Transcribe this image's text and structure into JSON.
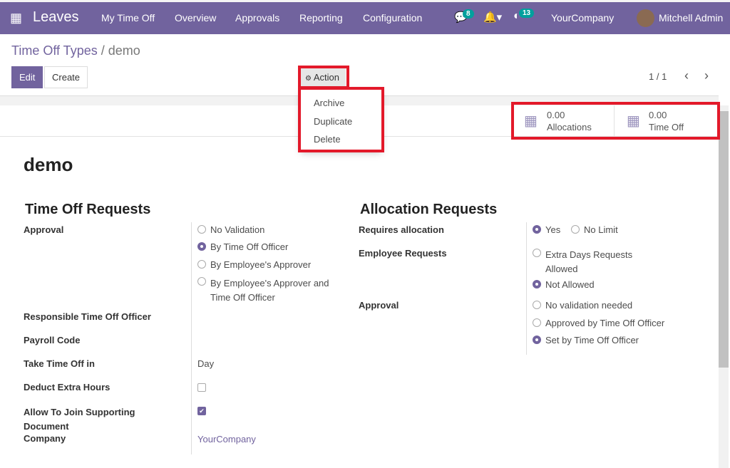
{
  "nav": {
    "app": "Leaves",
    "menu": [
      "My Time Off",
      "Overview",
      "Approvals",
      "Reporting",
      "Configuration"
    ],
    "messages_count": "8",
    "activities_count": "13",
    "company": "YourCompany",
    "user": "Mitchell Admin"
  },
  "breadcrumb": {
    "parent": "Time Off Types",
    "current": "demo"
  },
  "toolbar": {
    "edit": "Edit",
    "create": "Create",
    "action": "Action",
    "pager": "1 / 1"
  },
  "action_menu": [
    "Archive",
    "Duplicate",
    "Delete"
  ],
  "smart_buttons": [
    {
      "value": "0.00",
      "label": "Allocations"
    },
    {
      "value": "0.00",
      "label": "Time Off"
    }
  ],
  "record": {
    "name": "demo"
  },
  "left": {
    "title": "Time Off Requests",
    "approval_label": "Approval",
    "approval_options": [
      "No Validation",
      "By Time Off Officer",
      "By Employee's Approver",
      "By Employee's Approver and Time Off Officer"
    ],
    "approval_selected": 1,
    "officer_label": "Responsible Time Off Officer",
    "payroll_label": "Payroll Code",
    "take_label": "Take Time Off in",
    "take_value": "Day",
    "deduct_label": "Deduct Extra Hours",
    "deduct_checked": false,
    "join_label": "Allow To Join Supporting Document",
    "join_checked": true,
    "company_label": "Company",
    "company_value": "YourCompany"
  },
  "right": {
    "title": "Allocation Requests",
    "requires_label": "Requires allocation",
    "requires_options": [
      "Yes",
      "No Limit"
    ],
    "employee_label": "Employee Requests",
    "employee_options": [
      "Extra Days Requests Allowed",
      "Not Allowed"
    ],
    "approval_label": "Approval",
    "approval_options": [
      "No validation needed",
      "Approved by Time Off Officer",
      "Set by Time Off Officer"
    ]
  },
  "colors": {
    "brand": "#71639e",
    "highlight": "#e3192a",
    "badge": "#00a09d"
  }
}
